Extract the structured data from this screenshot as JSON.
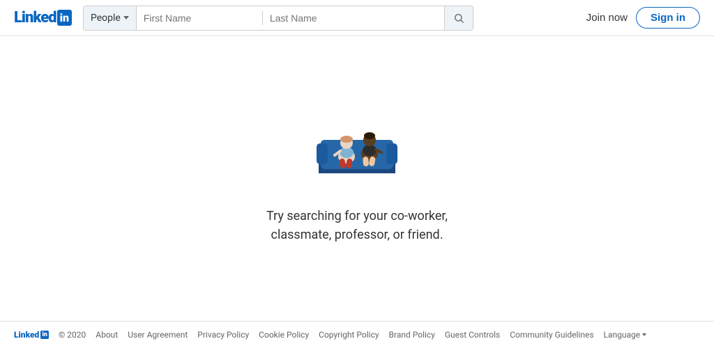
{
  "header": {
    "logo_text": "Linked",
    "logo_in": "in",
    "search": {
      "category_label": "People",
      "first_name_placeholder": "First Name",
      "last_name_placeholder": "Last Name"
    },
    "join_now_label": "Join now",
    "sign_in_label": "Sign in"
  },
  "main": {
    "message_line1": "Try searching for your co-worker,",
    "message_line2": "classmate, professor, or friend."
  },
  "footer": {
    "logo_text": "Linked",
    "logo_in": "in",
    "copyright": "© 2020",
    "links": [
      {
        "label": "About"
      },
      {
        "label": "User Agreement"
      },
      {
        "label": "Privacy Policy"
      },
      {
        "label": "Cookie Policy"
      },
      {
        "label": "Copyright Policy"
      },
      {
        "label": "Brand Policy"
      },
      {
        "label": "Guest Controls"
      },
      {
        "label": "Community Guidelines"
      },
      {
        "label": "Language"
      }
    ]
  },
  "colors": {
    "linkedin_blue": "#0a66c2",
    "dark_blue": "#1c4880"
  }
}
